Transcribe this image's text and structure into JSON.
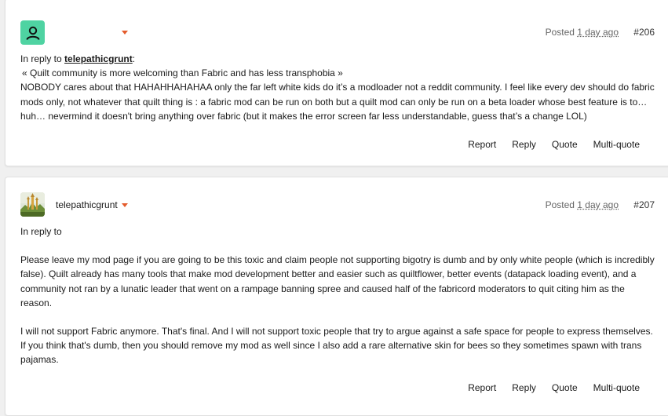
{
  "posts": [
    {
      "username": "",
      "posted_prefix": "Posted",
      "posted_ago": "1 day ago",
      "number": "#206",
      "reply_prefix": "In reply to",
      "reply_user": "telepathicgrunt",
      "reply_suffix": ":",
      "quote": "« Quilt community is more welcoming than Fabric and has less transphobia »",
      "paragraph": "NOBODY cares about that HAHAHHAHAHAA only the far left white kids do it’s a modloader not a reddit community. I feel like every dev should do fabric mods only, not whatever that quilt thing is : a fabric mod can be run on both but a quilt mod can only be run on a beta loader whose best feature is to… huh… nevermind it doesn't bring anything over fabric (but it makes the error screen far less understandable, guess that’s a change LOL)",
      "actions": {
        "report": "Report",
        "reply": "Reply",
        "quote": "Quote",
        "multiquote": "Multi-quote"
      }
    },
    {
      "username": "telepathicgrunt",
      "posted_prefix": "Posted",
      "posted_ago": "1 day ago",
      "number": "#207",
      "reply_prefix": "In reply to",
      "paragraph1": "Please leave my mod page if you are going to be this toxic and claim people not supporting bigotry is dumb and by only white people (which is incredibly false). Quilt already has many tools that make mod development better and easier such as quiltflower, better events (datapack loading event), and a community not ran by a lunatic leader that went on a rampage banning spree and caused half of the fabricord moderators to quit citing him as the reason.",
      "paragraph2": "I will not support Fabric anymore. That's final. And I will not support toxic people that try to argue against a safe space for people to express themselves. If you think that's dumb, then you should remove my mod as well since I also add a rare alternative skin for bees so they sometimes spawn with trans pajamas.",
      "actions": {
        "report": "Report",
        "reply": "Reply",
        "quote": "Quote",
        "multiquote": "Multi-quote"
      }
    }
  ],
  "icons": {
    "user_menu": "caret-down-icon",
    "default_avatar": "person-icon"
  },
  "colors": {
    "accent": "#e45b2c",
    "avatar_bg": "#4fd3a2"
  }
}
